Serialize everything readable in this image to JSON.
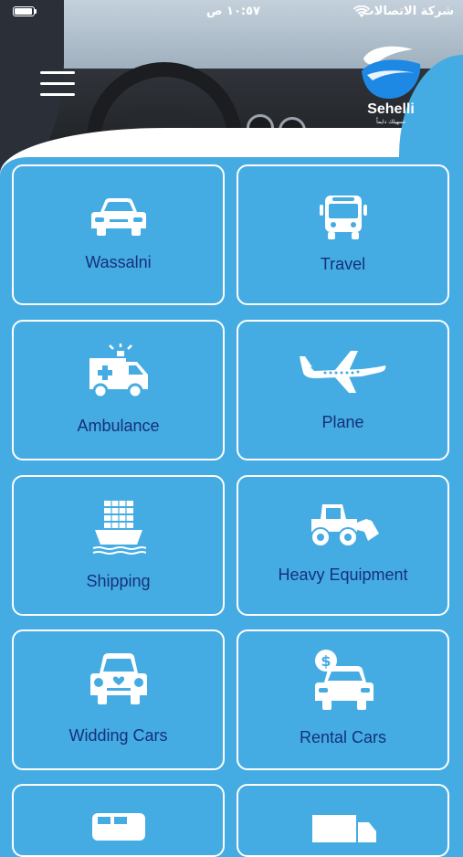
{
  "status_bar": {
    "time": "١٠:٥٧ ص",
    "carrier": "شركة الاتصالات"
  },
  "app": {
    "logo_text": "Sehelli",
    "logo_subtitle": "تسهيلك دايماً"
  },
  "services": [
    {
      "label": "Wassalni",
      "icon": "car-icon"
    },
    {
      "label": "Travel",
      "icon": "bus-icon"
    },
    {
      "label": "Ambulance",
      "icon": "ambulance-icon"
    },
    {
      "label": "Plane",
      "icon": "plane-icon"
    },
    {
      "label": "Shipping",
      "icon": "ship-icon"
    },
    {
      "label": "Heavy Equipment",
      "icon": "loader-icon"
    },
    {
      "label": "Widding Cars",
      "icon": "wedding-car-icon"
    },
    {
      "label": "Rental Cars",
      "icon": "rental-car-icon"
    }
  ],
  "colors": {
    "background": "#45ace3",
    "label": "#14317a",
    "tile_border": "#ffffff"
  }
}
